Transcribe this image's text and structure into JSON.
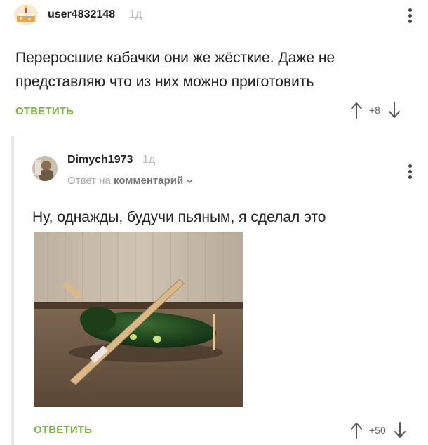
{
  "comments": [
    {
      "username": "user4832148",
      "time": "1д",
      "text": "Переросшие кабачки они же жёсткие. Даже не представляю что из них можно приготовить",
      "reply_label": "ОТВЕТИТЬ",
      "score": "+8"
    },
    {
      "username": "Dimych1973",
      "time": "1д",
      "reply_to_prefix": "Ответ на",
      "reply_to_link": "комментарий",
      "text": "Ну, однажды, будучи пьяным, я сделал это",
      "reply_label": "ОТВЕТИТЬ",
      "score": "+50"
    }
  ],
  "colors": {
    "accent": "#79b93f",
    "muted": "#aaaaaa"
  },
  "icons": [
    "avatar-cake-icon",
    "kebab-menu-icon",
    "upvote-arrow-icon",
    "downvote-arrow-icon",
    "chevron-down-icon"
  ]
}
